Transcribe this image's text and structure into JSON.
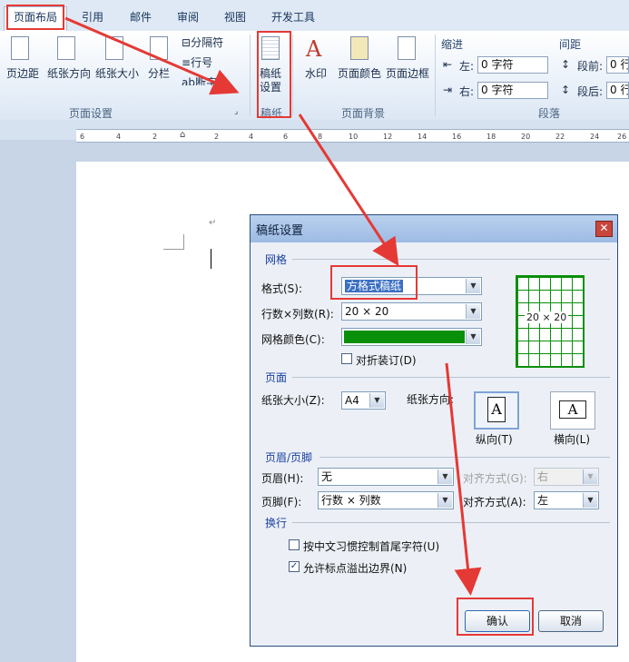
{
  "tabs": [
    "页面布局",
    "引用",
    "邮件",
    "审阅",
    "视图",
    "开发工具"
  ],
  "ribbon": {
    "page_setup": {
      "buttons": [
        "页边距",
        "纸张方向",
        "纸张大小",
        "分栏"
      ],
      "small": [
        "分隔符",
        "行号",
        "断字"
      ],
      "label": "页面设置"
    },
    "manuscript": {
      "button_line1": "稿纸",
      "button_line2": "设置",
      "label": "稿纸"
    },
    "background": {
      "buttons": [
        "水印",
        "页面颜色",
        "页面边框"
      ],
      "label": "页面背景"
    },
    "paragraph": {
      "indent_header": "缩进",
      "spacing_header": "间距",
      "left_label": "左:",
      "left_value": "0 字符",
      "right_label": "右:",
      "right_value": "0 字符",
      "before_label": "段前:",
      "before_value": "0 行",
      "after_label": "段后:",
      "after_value": "0 行",
      "label": "段落"
    }
  },
  "ruler": [
    "6",
    "4",
    "2",
    "2",
    "4",
    "6",
    "8",
    "10",
    "12",
    "14",
    "16",
    "18",
    "20",
    "22",
    "24",
    "26"
  ],
  "dialog": {
    "title": "稿纸设置",
    "close": "✕",
    "grid_section": "网格",
    "format_label": "格式(S):",
    "format_value": "方格式稿纸",
    "rows_label": "行数×列数(R):",
    "rows_value": "20 × 20",
    "color_label": "网格颜色(C):",
    "grid_color": "#0a8f0a",
    "fold_label": "对折装订(D)",
    "preview_text": "20 × 20",
    "page_section": "页面",
    "size_label": "纸张大小(Z):",
    "size_value": "A4",
    "orient_label": "纸张方向:",
    "portrait_label": "纵向(T)",
    "landscape_label": "横向(L)",
    "hf_section": "页眉/页脚",
    "header_label": "页眉(H):",
    "header_value": "无",
    "header_align_label": "对齐方式(G):",
    "header_align_value": "右",
    "footer_label": "页脚(F):",
    "footer_value": "行数 × 列数",
    "footer_align_label": "对齐方式(A):",
    "footer_align_value": "左",
    "wrap_section": "换行",
    "wrap_opt1": "按中文习惯控制首尾字符(U)",
    "wrap_opt2": "允许标点溢出边界(N)",
    "ok": "确认",
    "cancel": "取消"
  },
  "colors": {
    "accent_red": "#e53935",
    "grid_green": "#0a8f0a"
  }
}
